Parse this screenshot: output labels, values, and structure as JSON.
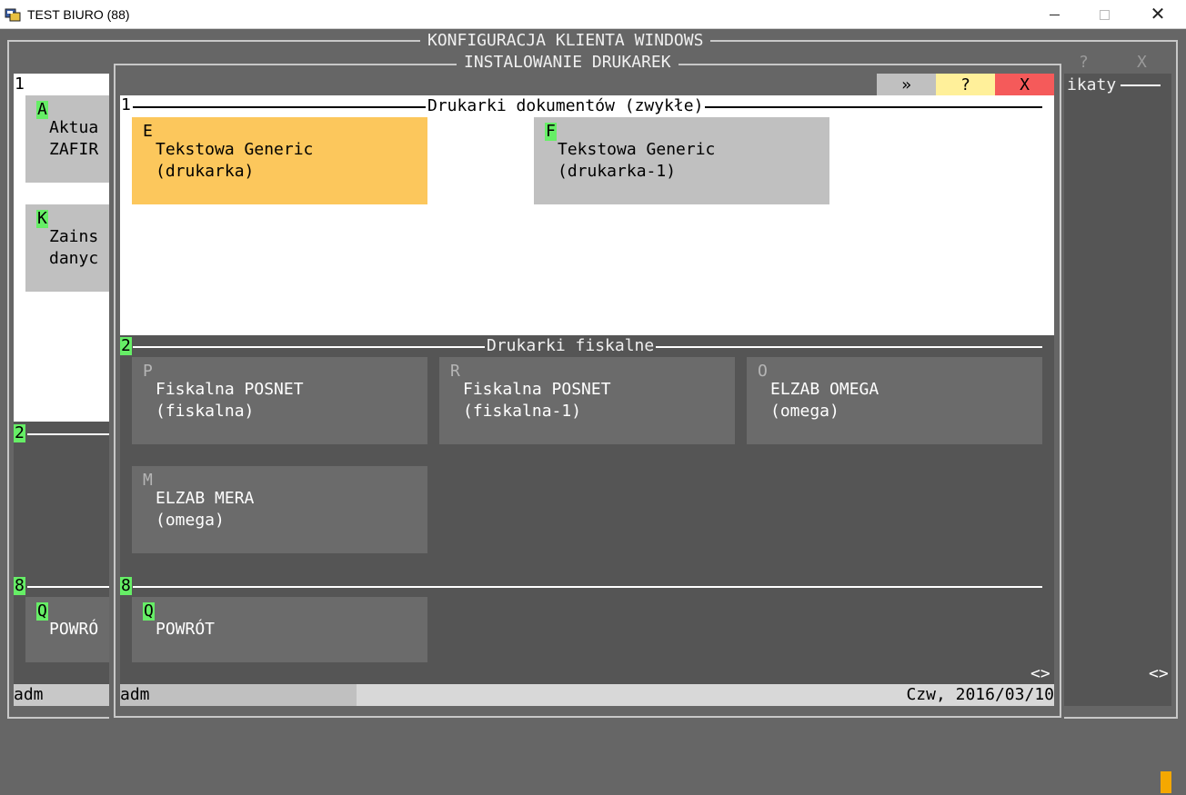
{
  "window": {
    "title": "TEST BIURO (88)",
    "minimize_icon": "minimize-icon",
    "maximize_icon": "maximize-icon",
    "close_icon": "close-icon"
  },
  "outer": {
    "title": "KONFIGURACJA KLIENTA WINDOWS",
    "help_label": "?",
    "close_label": "X",
    "right_fragment": "ikaty",
    "section1_num": "1",
    "section2_num": "2",
    "section8_num": "8",
    "tiles": [
      {
        "key": "A",
        "line1": "Aktua",
        "line2": "ZAFIR"
      },
      {
        "key": "K",
        "line1": "Zains",
        "line2": "danyc"
      }
    ],
    "back_tile": {
      "key": "Q",
      "line1": "POWRÓ"
    },
    "status_user": "adm",
    "scroll_arrows": "<>"
  },
  "dialog": {
    "title": "INSTALOWANIE DRUKAREK",
    "toolbar": {
      "next_label": "»",
      "help_label": "?",
      "close_label": "X",
      "next_color": "#c0c0c0",
      "help_color": "#fff09a",
      "close_color": "#f55a5a"
    },
    "section1": {
      "num": "1",
      "title": "Drukarki dokumentów (zwykłe)",
      "tiles": [
        {
          "key": "E",
          "line1": "Tekstowa Generic",
          "line2": "(drukarka)",
          "selected": true
        },
        {
          "key": "F",
          "line1": "Tekstowa Generic",
          "line2": "(drukarka-1)",
          "selected": false
        }
      ]
    },
    "section2": {
      "num": "2",
      "title": "Drukarki fiskalne",
      "tiles": [
        {
          "key": "P",
          "line1": "Fiskalna POSNET",
          "line2": "(fiskalna)"
        },
        {
          "key": "R",
          "line1": "Fiskalna POSNET",
          "line2": "(fiskalna-1)"
        },
        {
          "key": "O",
          "line1": "ELZAB OMEGA",
          "line2": "(omega)"
        },
        {
          "key": "M",
          "line1": "ELZAB MERA",
          "line2": "(omega)"
        }
      ]
    },
    "section8": {
      "num": "8",
      "tiles": [
        {
          "key": "Q",
          "line1": "POWRÓT"
        }
      ]
    },
    "scroll_arrows": "<>",
    "status": {
      "user": "adm",
      "date": "Czw, 2016/03/10"
    }
  },
  "colors": {
    "background": "#666666",
    "accent_orange": "#fcc75c",
    "hotkey_green": "#66ee66",
    "cursor_orange": "#f5a800"
  }
}
